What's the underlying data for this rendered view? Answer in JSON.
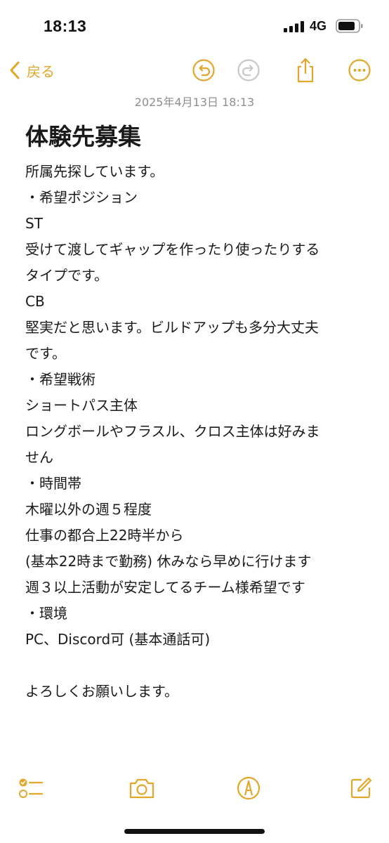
{
  "status_bar": {
    "time": "18:13",
    "network": "4G"
  },
  "toolbar": {
    "back_label": "戻る"
  },
  "note": {
    "date": "2025年4月13日 18:13",
    "title": "体験先募集",
    "lines": [
      "所属先探しています。",
      "・希望ポジション",
      "ST",
      "受けて渡してギャップを作ったり使ったりする",
      "タイプです。",
      "CB",
      "堅実だと思います。ビルドアップも多分大丈夫",
      "です。",
      "・希望戦術",
      "ショートパス主体",
      "ロングボールやフラスル、クロス主体は好みま",
      "せん",
      "・時間帯",
      "木曜以外の週５程度",
      "仕事の都合上22時半から",
      "(基本22時まで勤務) 休みなら早めに行けます",
      "週３以上活動が安定してるチーム様希望です",
      "・環境",
      "PC、Discord可 (基本通話可)",
      "",
      "よろしくお願いします。"
    ]
  },
  "colors": {
    "accent": "#E0A72A",
    "disabled": "#C7C7CC",
    "date_text": "#8E8E93"
  },
  "icons": {
    "toolbar": [
      "undo-icon",
      "redo-icon",
      "share-icon",
      "more-icon"
    ],
    "bottom": [
      "checklist-icon",
      "camera-icon",
      "markup-icon",
      "compose-icon"
    ]
  }
}
